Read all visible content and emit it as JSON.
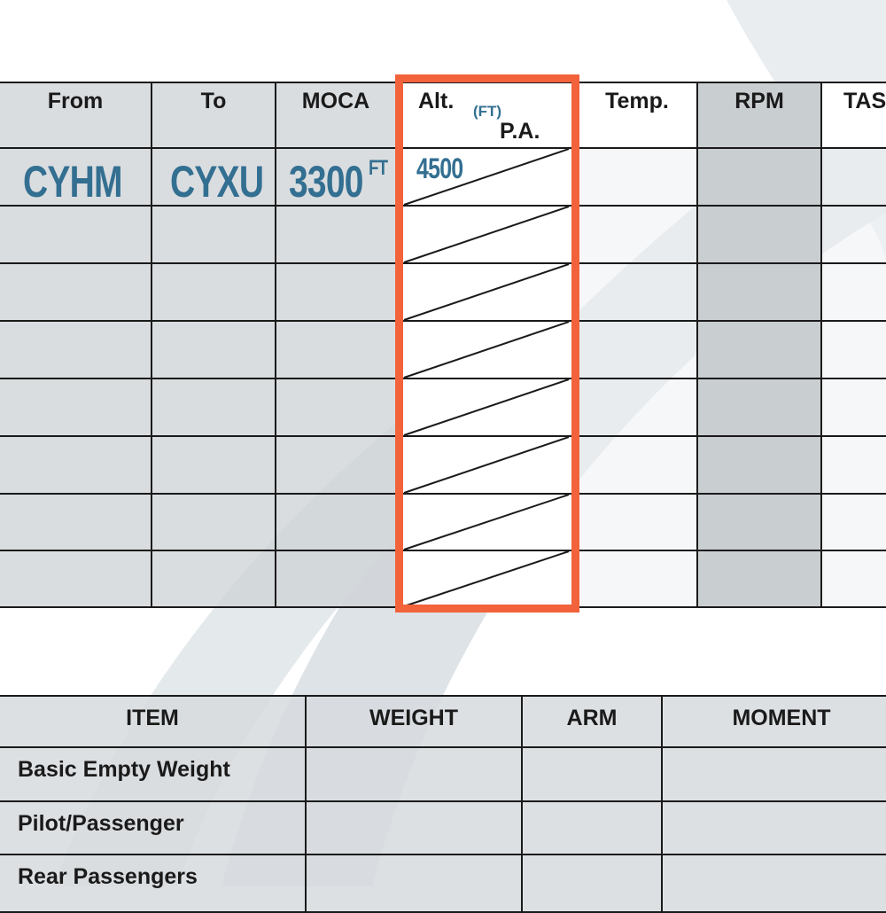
{
  "flight_log": {
    "headers": {
      "from": "From",
      "to": "To",
      "moca": "MOCA",
      "alt": "Alt.",
      "alt_unit": "(FT)",
      "pa": "P.A.",
      "temp": "Temp.",
      "rpm": "RPM",
      "tas": "TAS"
    },
    "first_row": {
      "from": "CYHM",
      "to": "CYXU",
      "moca": "3300",
      "moca_unit": "FT",
      "alt": "4500"
    },
    "empty_rows": 8,
    "highlight_color": "#f2623b",
    "value_color": "#336f91"
  },
  "weight_balance": {
    "headers": [
      "ITEM",
      "WEIGHT",
      "ARM",
      "MOMENT"
    ],
    "items": [
      "Basic Empty Weight",
      "Pilot/Passenger",
      "Rear Passengers"
    ]
  }
}
